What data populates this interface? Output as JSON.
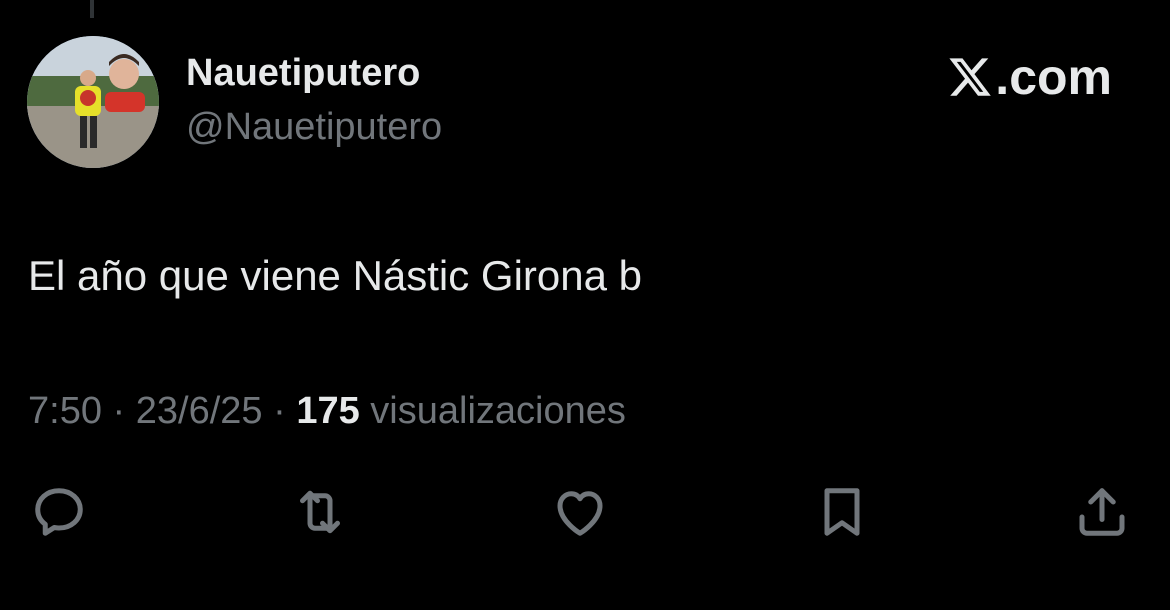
{
  "tweet": {
    "author": {
      "name": "Nauetiputero",
      "handle": "@Nauetiputero"
    },
    "brand": ".com",
    "text": "El año que viene Nástic Girona b",
    "meta": {
      "time": "7:50",
      "date": "23/6/25",
      "separator": "·",
      "views_count": "175",
      "views_label": "visualizaciones"
    },
    "actions": [
      {
        "icon": "reply-icon"
      },
      {
        "icon": "retweet-icon"
      },
      {
        "icon": "heart-icon"
      },
      {
        "icon": "bookmark-icon"
      },
      {
        "icon": "share-icon"
      }
    ]
  },
  "colors": {
    "background": "#000000",
    "primary_text": "#e7e9ea",
    "secondary_text": "#71767b"
  }
}
